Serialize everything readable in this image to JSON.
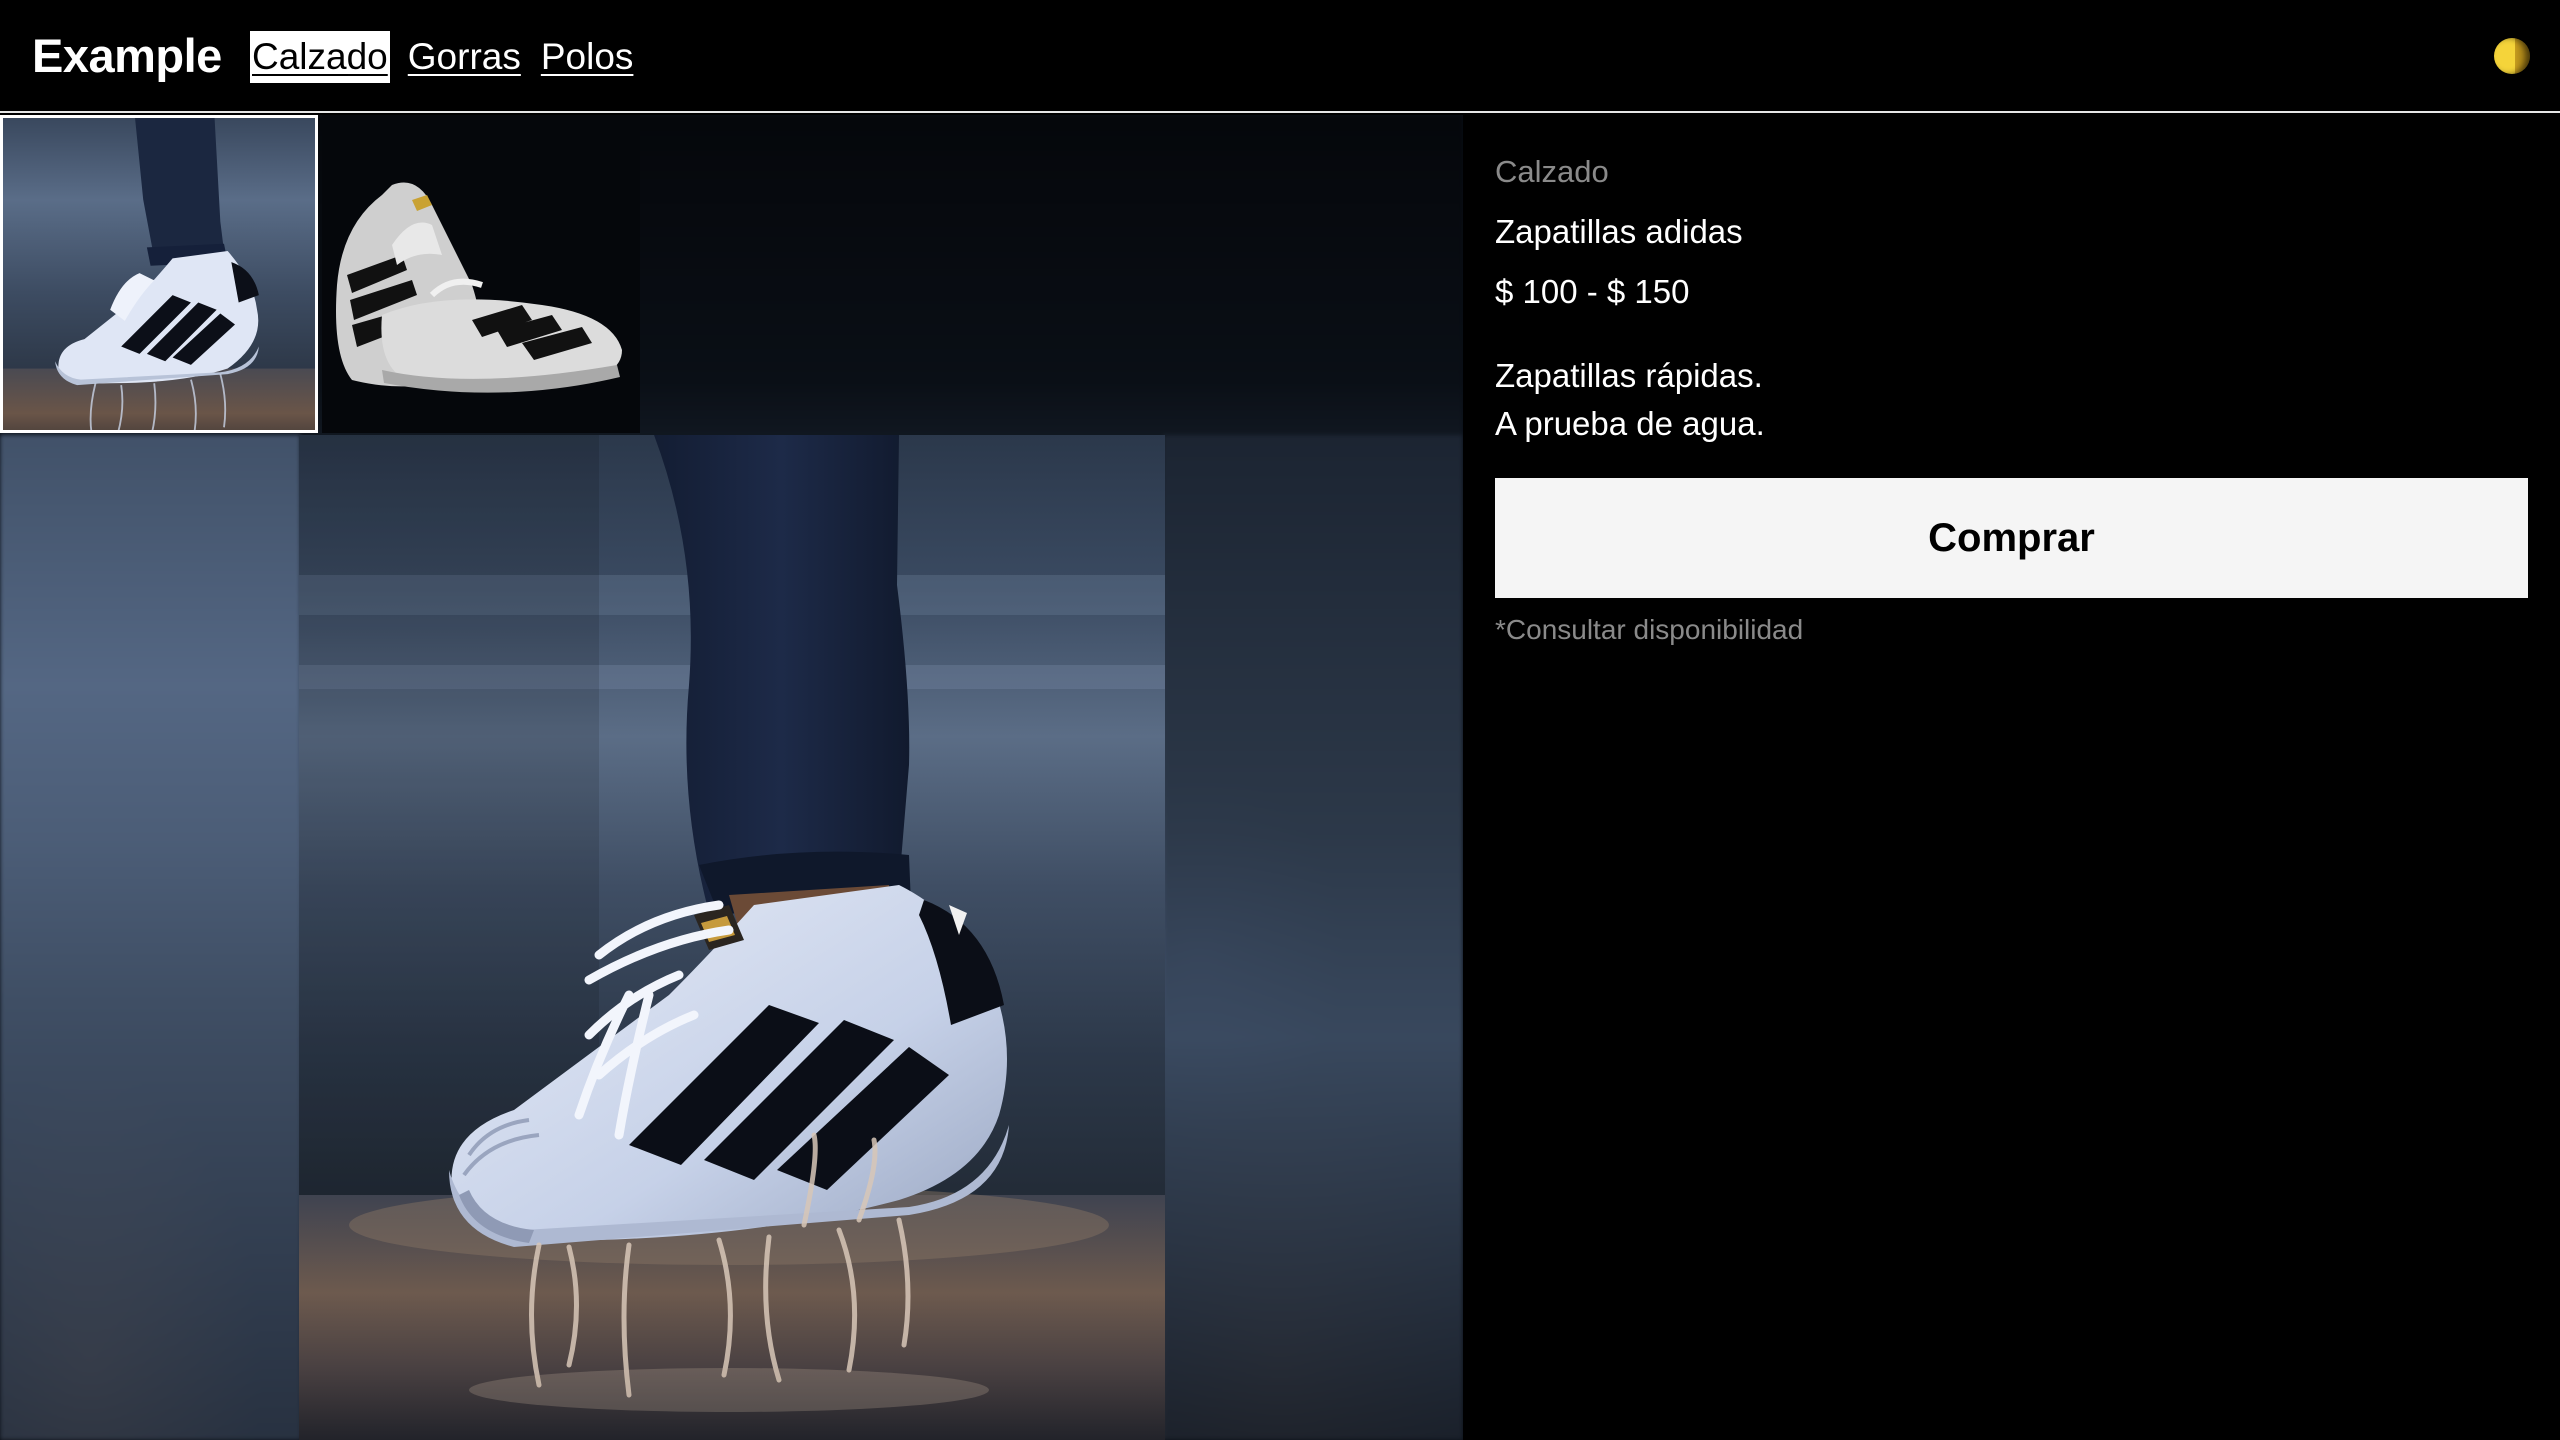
{
  "header": {
    "brand": "Example",
    "nav": [
      {
        "label": "Calzado",
        "active": true
      },
      {
        "label": "Gorras",
        "active": false
      },
      {
        "label": "Polos",
        "active": false
      }
    ],
    "theme_icon": "moon-icon",
    "theme_color": "#f5d43a"
  },
  "gallery": {
    "thumbnails": [
      {
        "icon": "shoe-splash-photo",
        "selected": true
      },
      {
        "icon": "shoe-pair-photo",
        "selected": false
      }
    ],
    "main_image_icon": "shoe-splash-photo"
  },
  "product": {
    "category": "Calzado",
    "name": "Zapatillas adidas",
    "price": "$ 100 - $ 150",
    "description_lines": [
      "Zapatillas rápidas.",
      "A prueba de agua."
    ],
    "buy_label": "Comprar",
    "availability_note": "*Consultar disponibilidad"
  }
}
